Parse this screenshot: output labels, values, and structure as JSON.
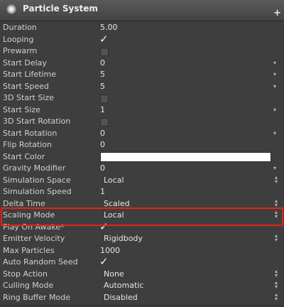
{
  "header": {
    "title": "Particle System",
    "plus_label": "+"
  },
  "rows": [
    {
      "label": "Duration",
      "value": "5.00",
      "kind": "text"
    },
    {
      "label": "Looping",
      "kind": "check",
      "checked": true
    },
    {
      "label": "Prewarm",
      "kind": "check",
      "checked": false
    },
    {
      "label": "Start Delay",
      "value": "0",
      "kind": "dropdown"
    },
    {
      "label": "Start Lifetime",
      "value": "5",
      "kind": "dropdown"
    },
    {
      "label": "Start Speed",
      "value": "5",
      "kind": "dropdown"
    },
    {
      "label": "3D Start Size",
      "kind": "check",
      "checked": false
    },
    {
      "label": "Start Size",
      "value": "1",
      "kind": "dropdown"
    },
    {
      "label": "3D Start Rotation",
      "kind": "check",
      "checked": false
    },
    {
      "label": "Start Rotation",
      "value": "0",
      "kind": "dropdown"
    },
    {
      "label": "Flip Rotation",
      "value": "0",
      "kind": "text"
    },
    {
      "label": "Start Color",
      "kind": "color",
      "color": "#ffffff"
    },
    {
      "label": "Gravity Modifier",
      "value": "0",
      "kind": "dropdown"
    },
    {
      "label": "Simulation Space",
      "value": "Local",
      "kind": "select"
    },
    {
      "label": "Simulation Speed",
      "value": "1",
      "kind": "text"
    },
    {
      "label": "Delta Time",
      "value": "Scaled",
      "kind": "select"
    },
    {
      "label": "Scaling Mode",
      "value": "Local",
      "kind": "select"
    },
    {
      "label": "Play On Awake*",
      "kind": "check",
      "checked": true
    },
    {
      "label": "Emitter Velocity",
      "value": "Rigidbody",
      "kind": "select"
    },
    {
      "label": "Max Particles",
      "value": "1000",
      "kind": "text"
    },
    {
      "label": "Auto Random Seed",
      "kind": "check",
      "checked": true
    },
    {
      "label": "Stop Action",
      "value": "None",
      "kind": "select"
    },
    {
      "label": "Culling Mode",
      "value": "Automatic",
      "kind": "select"
    },
    {
      "label": "Ring Buffer Mode",
      "value": "Disabled",
      "kind": "select"
    }
  ],
  "colors": {
    "panel_bg": "#3e3e3e",
    "highlight": "#e5231b"
  },
  "glyphs": {
    "dropdown_arrow": "▾",
    "updown": "▴▾",
    "checkmark": "✓"
  }
}
